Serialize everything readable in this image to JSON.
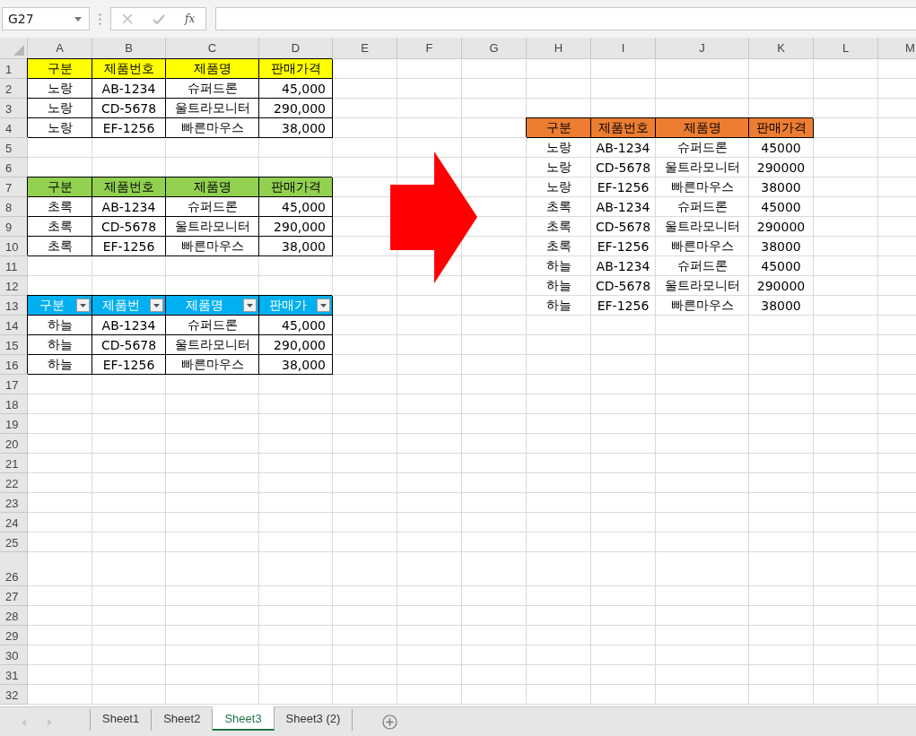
{
  "name_box": "G27",
  "formula_bar": {
    "function_label": "fx"
  },
  "columns": [
    "A",
    "B",
    "C",
    "D",
    "E",
    "F",
    "G",
    "H",
    "I",
    "J",
    "K",
    "L",
    "M"
  ],
  "rows": [
    {
      "label": "1",
      "cells": {
        "A": {
          "kind": "header",
          "text": "구분",
          "color": "#ffff00"
        },
        "B": {
          "kind": "header",
          "text": "제품번호",
          "color": "#ffff00"
        },
        "C": {
          "kind": "header",
          "text": "제품명",
          "color": "#ffff00"
        },
        "D": {
          "kind": "header",
          "text": "판매가격",
          "color": "#ffff00"
        }
      }
    },
    {
      "label": "2",
      "cells": {
        "A": {
          "kind": "cell",
          "text": "노랑"
        },
        "B": {
          "kind": "cell",
          "text": "AB-1234"
        },
        "C": {
          "kind": "cell",
          "text": "슈퍼드론"
        },
        "D": {
          "kind": "number",
          "text": "45,000"
        }
      }
    },
    {
      "label": "3",
      "cells": {
        "A": {
          "kind": "cell",
          "text": "노랑"
        },
        "B": {
          "kind": "cell",
          "text": "CD-5678"
        },
        "C": {
          "kind": "cell",
          "text": "울트라모니터"
        },
        "D": {
          "kind": "number",
          "text": "290,000"
        }
      }
    },
    {
      "label": "4",
      "cells": {
        "A": {
          "kind": "cell",
          "text": "노랑"
        },
        "B": {
          "kind": "cell",
          "text": "EF-1256"
        },
        "C": {
          "kind": "cell",
          "text": "빠른마우스"
        },
        "D": {
          "kind": "number",
          "text": "38,000"
        },
        "H": {
          "kind": "header",
          "text": "구분",
          "color": "#ed7d31"
        },
        "I": {
          "kind": "header",
          "text": "제품번호",
          "color": "#ed7d31"
        },
        "J": {
          "kind": "header",
          "text": "제품명",
          "color": "#ed7d31"
        },
        "K": {
          "kind": "header",
          "text": "판매가격",
          "color": "#ed7d31"
        }
      }
    },
    {
      "label": "5",
      "cells": {
        "H": {
          "kind": "plain",
          "text": "노랑"
        },
        "I": {
          "kind": "plain",
          "text": "AB-1234"
        },
        "J": {
          "kind": "plain",
          "text": "슈퍼드론"
        },
        "K": {
          "kind": "plain",
          "text": "45000"
        }
      }
    },
    {
      "label": "6",
      "cells": {
        "H": {
          "kind": "plain",
          "text": "노랑"
        },
        "I": {
          "kind": "plain",
          "text": "CD-5678"
        },
        "J": {
          "kind": "plain",
          "text": "울트라모니터"
        },
        "K": {
          "kind": "plain",
          "text": "290000"
        }
      }
    },
    {
      "label": "7",
      "cells": {
        "A": {
          "kind": "header",
          "text": "구분",
          "color": "#92d050"
        },
        "B": {
          "kind": "header",
          "text": "제품번호",
          "color": "#92d050"
        },
        "C": {
          "kind": "header",
          "text": "제품명",
          "color": "#92d050"
        },
        "D": {
          "kind": "header",
          "text": "판매가격",
          "color": "#92d050"
        },
        "H": {
          "kind": "plain",
          "text": "노랑"
        },
        "I": {
          "kind": "plain",
          "text": "EF-1256"
        },
        "J": {
          "kind": "plain",
          "text": "빠른마우스"
        },
        "K": {
          "kind": "plain",
          "text": "38000"
        }
      }
    },
    {
      "label": "8",
      "cells": {
        "A": {
          "kind": "cell",
          "text": "초록"
        },
        "B": {
          "kind": "cell",
          "text": "AB-1234"
        },
        "C": {
          "kind": "cell",
          "text": "슈퍼드론"
        },
        "D": {
          "kind": "number",
          "text": "45,000"
        },
        "H": {
          "kind": "plain",
          "text": "초록"
        },
        "I": {
          "kind": "plain",
          "text": "AB-1234"
        },
        "J": {
          "kind": "plain",
          "text": "슈퍼드론"
        },
        "K": {
          "kind": "plain",
          "text": "45000"
        }
      }
    },
    {
      "label": "9",
      "cells": {
        "A": {
          "kind": "cell",
          "text": "초록"
        },
        "B": {
          "kind": "cell",
          "text": "CD-5678"
        },
        "C": {
          "kind": "cell",
          "text": "울트라모니터"
        },
        "D": {
          "kind": "number",
          "text": "290,000"
        },
        "H": {
          "kind": "plain",
          "text": "초록"
        },
        "I": {
          "kind": "plain",
          "text": "CD-5678"
        },
        "J": {
          "kind": "plain",
          "text": "울트라모니터"
        },
        "K": {
          "kind": "plain",
          "text": "290000"
        }
      }
    },
    {
      "label": "10",
      "cells": {
        "A": {
          "kind": "cell",
          "text": "초록"
        },
        "B": {
          "kind": "cell",
          "text": "EF-1256"
        },
        "C": {
          "kind": "cell",
          "text": "빠른마우스"
        },
        "D": {
          "kind": "number",
          "text": "38,000"
        },
        "H": {
          "kind": "plain",
          "text": "초록"
        },
        "I": {
          "kind": "plain",
          "text": "EF-1256"
        },
        "J": {
          "kind": "plain",
          "text": "빠른마우스"
        },
        "K": {
          "kind": "plain",
          "text": "38000"
        }
      }
    },
    {
      "label": "11",
      "cells": {
        "H": {
          "kind": "plain",
          "text": "하늘"
        },
        "I": {
          "kind": "plain",
          "text": "AB-1234"
        },
        "J": {
          "kind": "plain",
          "text": "슈퍼드론"
        },
        "K": {
          "kind": "plain",
          "text": "45000"
        }
      }
    },
    {
      "label": "12",
      "cells": {
        "H": {
          "kind": "plain",
          "text": "하늘"
        },
        "I": {
          "kind": "plain",
          "text": "CD-5678"
        },
        "J": {
          "kind": "plain",
          "text": "울트라모니터"
        },
        "K": {
          "kind": "plain",
          "text": "290000"
        }
      }
    },
    {
      "label": "13",
      "cells": {
        "A": {
          "kind": "filter-header",
          "text": "구분",
          "color": "#00b0f0"
        },
        "B": {
          "kind": "filter-header",
          "text": "제품번",
          "color": "#00b0f0"
        },
        "C": {
          "kind": "filter-header",
          "text": "제품명",
          "color": "#00b0f0"
        },
        "D": {
          "kind": "filter-header",
          "text": "판매가",
          "color": "#00b0f0"
        },
        "H": {
          "kind": "plain",
          "text": "하늘"
        },
        "I": {
          "kind": "plain",
          "text": "EF-1256"
        },
        "J": {
          "kind": "plain",
          "text": "빠른마우스"
        },
        "K": {
          "kind": "plain",
          "text": "38000"
        }
      }
    },
    {
      "label": "14",
      "cells": {
        "A": {
          "kind": "cell",
          "text": "하늘"
        },
        "B": {
          "kind": "cell",
          "text": "AB-1234"
        },
        "C": {
          "kind": "cell",
          "text": "슈퍼드론"
        },
        "D": {
          "kind": "number",
          "text": "45,000"
        }
      }
    },
    {
      "label": "15",
      "cells": {
        "A": {
          "kind": "cell",
          "text": "하늘"
        },
        "B": {
          "kind": "cell",
          "text": "CD-5678"
        },
        "C": {
          "kind": "cell",
          "text": "울트라모니터"
        },
        "D": {
          "kind": "number",
          "text": "290,000"
        }
      }
    },
    {
      "label": "16",
      "cells": {
        "A": {
          "kind": "cell",
          "text": "하늘"
        },
        "B": {
          "kind": "cell",
          "text": "EF-1256"
        },
        "C": {
          "kind": "cell",
          "text": "빠른마우스"
        },
        "D": {
          "kind": "number",
          "text": "38,000"
        }
      }
    },
    {
      "label": "17"
    },
    {
      "label": "18"
    },
    {
      "label": "19"
    },
    {
      "label": "20"
    },
    {
      "label": "21"
    },
    {
      "label": "22"
    },
    {
      "label": "23"
    },
    {
      "label": "24"
    },
    {
      "label": "25"
    },
    {
      "label": "26",
      "tall": true
    },
    {
      "label": "27"
    },
    {
      "label": "28"
    },
    {
      "label": "29"
    },
    {
      "label": "30"
    },
    {
      "label": "31"
    },
    {
      "label": "32"
    }
  ],
  "sheet_tabs": [
    {
      "label": "Sheet1",
      "selected": false
    },
    {
      "label": "Sheet2",
      "selected": false
    },
    {
      "label": "Sheet3",
      "selected": true
    },
    {
      "label": "Sheet3  (2)",
      "selected": false
    }
  ]
}
